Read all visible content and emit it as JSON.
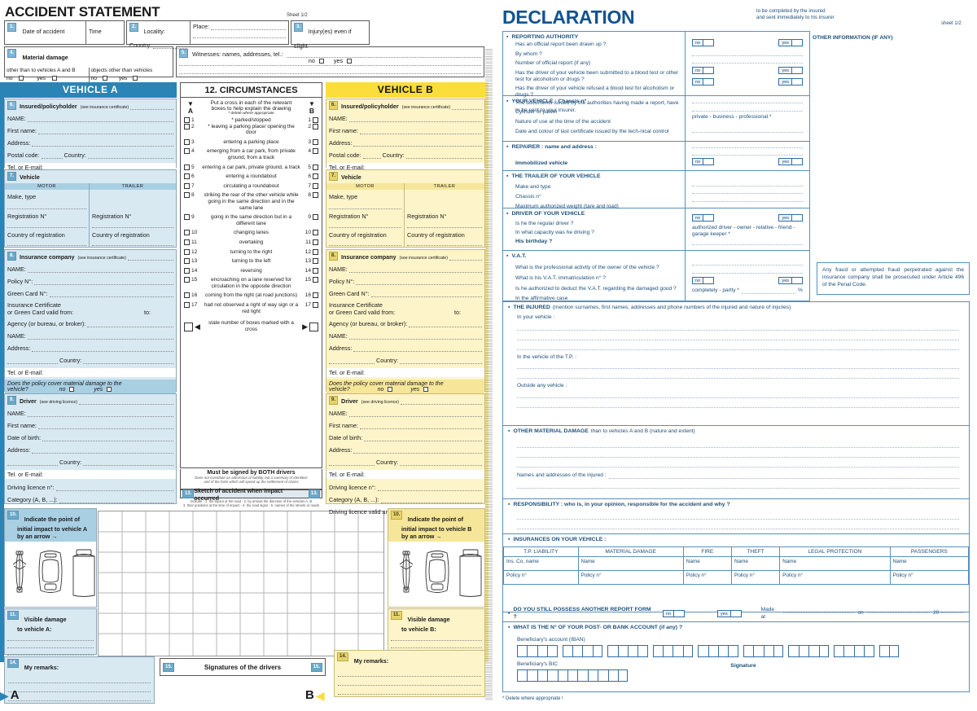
{
  "colors": {
    "blueA": "#2a84b5",
    "yellowB": "#fbdd3c",
    "panelA": "#d9e9f2",
    "panelB": "#fdf4c9",
    "declBlue": "#12538f"
  },
  "left": {
    "title": "ACCIDENT STATEMENT",
    "sheet": "Sheet 1/2",
    "f1": {
      "n": "1.",
      "date_label": "Date of accident",
      "time_label": "Time"
    },
    "f2": {
      "n": "2.",
      "locality_label": "Locality:",
      "country_label": "Country:",
      "place_label": "Place:"
    },
    "f3": {
      "n": "3.",
      "label": "Injury(es) even if slight",
      "no": "no",
      "yes": "yes"
    },
    "f4": {
      "n": "4.",
      "label": "Material damage",
      "opt1": "other than to vehicles A and B",
      "opt2": "objects other than vehicles",
      "no": "no",
      "yes": "yes"
    },
    "f5": {
      "n": "5.",
      "label": "Witnesses: names, addresses, tel.:"
    },
    "vehicle_a_header": "VEHICLE A",
    "vehicle_b_header": "VEHICLE B",
    "f6": {
      "n": "6.",
      "title": "Insured/policyholder",
      "note": "(see insurance certificate)",
      "name": "NAME:",
      "first_name": "First name:",
      "address": "Address:",
      "postal": "Postal code:",
      "country": "Country:",
      "tel": "Tel. or E-mail:"
    },
    "f7": {
      "n": "7.",
      "title": "Vehicle",
      "motor": "MOTOR",
      "trailer": "TRAILER",
      "make": "Make, type",
      "reg": "Registration N°",
      "country_reg": "Country of registration"
    },
    "f8": {
      "n": "8.",
      "title": "Insurance company",
      "note": "(see insurance certificate)",
      "name": "NAME:",
      "policy": "Policy N°:",
      "green_card": "Green Card N°:",
      "cert1": "Insurance Certificate",
      "cert2": "or Green Card valid from:",
      "to": "to:",
      "agency": "Agency (or bureau, or broker):",
      "agency_name": "NAME:",
      "address": "Address:",
      "country": "Country:",
      "tel": "Tel. or E-mail:",
      "cover1": "Does the policy cover material damage to the",
      "cover2": "vehicle?",
      "no": "no",
      "yes": "yes"
    },
    "f9": {
      "n": "9.",
      "title": "Driver",
      "note": "(see driving licence)",
      "name": "NAME:",
      "first_name": "First name:",
      "dob": "Date of birth:",
      "address": "Address:",
      "country": "Country:",
      "tel": "Tel. or E-mail:",
      "licence": "Driving licence n°:",
      "category": "Category (A, B, ...):",
      "valid": "Driving licence valid until:"
    },
    "f10": {
      "n": "10.",
      "l1a": "Indicate the point of",
      "l2a": "initial impact to vehicle A",
      "l2b": "initial impact to vehicle B",
      "l3": "by an arrow →"
    },
    "f11": {
      "n": "11.",
      "l1": "Visible damage",
      "l2a": "to vehicle A:",
      "l2b": "to vehicle B:"
    },
    "f14": {
      "n": "14.",
      "label": "My remarks:"
    },
    "f15": {
      "n": "15.",
      "label": "Signatures of the drivers"
    },
    "marker_a": "A",
    "marker_b": "B",
    "circumstances": {
      "title": "12. CIRCUMSTANCES",
      "instr1": "Put a cross in each of the relevant",
      "instr2": "boxes to help explain the drawing",
      "instr3": "* delete where appropriate",
      "col_a": "A",
      "col_b": "B",
      "items": [
        {
          "n": "1",
          "text": "* parked/stopped"
        },
        {
          "n": "2",
          "text": "* leaving a parking place/ opening the door"
        },
        {
          "n": "3",
          "text": "entering a parking place"
        },
        {
          "n": "4",
          "text": "emerging from a car park, from private ground, from a track"
        },
        {
          "n": "5",
          "text": "entering a car park, private ground, a track"
        },
        {
          "n": "6",
          "text": "entering a roundabout"
        },
        {
          "n": "7",
          "text": "circulating a roundabout"
        },
        {
          "n": "8",
          "text": "striking the rear of the other vehicle while going in the same direction and in the same lane"
        },
        {
          "n": "9",
          "text": "going in the same direction but in a different lane"
        },
        {
          "n": "10",
          "text": "changing lanes"
        },
        {
          "n": "11",
          "text": "overtaking"
        },
        {
          "n": "12",
          "text": "turning to the right"
        },
        {
          "n": "13",
          "text": "turning to the left"
        },
        {
          "n": "14",
          "text": "reversing"
        },
        {
          "n": "15",
          "text": "encroaching on a lane reserved for circulation in the opposite direction"
        },
        {
          "n": "16",
          "text": "coming from the right (at road junctions)"
        },
        {
          "n": "17",
          "text": "had not observed a right of way sign or a red light"
        }
      ],
      "total_text": "state number of boxes marked with a cross"
    },
    "signed_note": {
      "l1": "Must be signed by BOTH drivers",
      "l2": "Does not constitute an admission of liability, but a summary of identities",
      "l3": "and of the facts which will speed up the settlement of claims"
    },
    "f13": {
      "n": "13.",
      "title": "Sketch of accident when impact occurred",
      "note1": "Indicate : 1. the layout of the road - 2. by arrows the direction of the vehicles A, B",
      "note2": "3. their positions at the time of impact - 4. the road signs - 5. names of the streets or roads"
    }
  },
  "right": {
    "title": "DECLARATION",
    "subtitle1": "to be completed by the insured",
    "subtitle2": "and sent immediately to his insurer",
    "sheet": "sheet 1/2",
    "other_info": "OTHER INFORMATION (IF ANY)",
    "no": "no",
    "yes": "yes",
    "reporting": {
      "heading": "REPORTING AUTHORITY",
      "q1": "Has an official report been drawn up ?",
      "q2": "By whom ?",
      "q3": "Number of official report (if any)",
      "q4": "Has the driver of your vehicle been submitted to a blood test or other test for alcoholism or drugs ?",
      "q5": "Has the driver of your vehicle refused a blood test for alcoholism or drugs ?",
      "q6": "The documents issued by the authorities having made a report, have to be sent to your insurer."
    },
    "your_vehicle": {
      "heading": "YOUR VEHICLE : Chassis n°",
      "q1": "Cylinder or power",
      "q2": "Nature of use at the time of the accident",
      "q2_answer": "private - business - professional *",
      "q3": "Date and colour of last certificate issued by the tech-nical control"
    },
    "repairer": {
      "heading": "REPAIRER : name and address :",
      "immobilized": "Immobilized vehicle"
    },
    "trailer": {
      "heading": "THE TRAILER OF YOUR VEHICLE",
      "q1": "Make and type",
      "q2": "Chassis n°",
      "q3": "Maximum authorized weight (tare and load)"
    },
    "driver": {
      "heading": "DRIVER OF YOUR VEHICLE",
      "q1": "Is he the regular driver ?",
      "q2": "In what capacity was he driving ?",
      "q2_answer": "authorized driver - owner - relative - friend - garage keeper *",
      "q3": "His birthday ?"
    },
    "vat": {
      "heading": "V.A.T.",
      "q1": "What is the professional activity of the owner of the vehicle ?",
      "q2": "What is his V.A.T. immatriculation n° ?",
      "q3": "Is he authorized to deduct the V.A.T. regarding the damaged good ?",
      "q4": "In the affirmative case",
      "q4_answer": "completely - partly *",
      "percent": "%"
    },
    "fraud_warning": "Any fraud or attempted fraud perpetrated against the insurance company shall be prosecuted under Article 496 of the Penal Code.",
    "injured": {
      "heading": "THE INJURED",
      "heading_rest": "(mention surnames, first names, addresses and phone numbers of the injured and nature of injuries)",
      "s1": "In your vehicle :",
      "s2": "In the vehicle of the T.P. :",
      "s3": "Outside any vehicle :"
    },
    "other_damage": {
      "heading": "OTHER MATERIAL DAMAGE",
      "heading_rest": "than to vehicles A and B (nature and extent)",
      "names": "Names and addresses of the injured :"
    },
    "responsibility": {
      "heading": "RESPONSIBILITY : who is, in your opinion, responsible for the accident and why ?"
    },
    "insurances": {
      "heading": "INSURANCES ON YOUR VEHICLE :",
      "columns": [
        "T.P. LIABILITY",
        "MATERIAL DAMAGE",
        "FIRE",
        "THEFT",
        "LEGAL PROTECTION",
        "PASSENGERS"
      ],
      "row1": [
        "Ins. Co, name",
        "Name",
        "Name",
        "Name",
        "Name",
        "Name"
      ],
      "row2": [
        "Policy n°",
        "Policy n°",
        "Policy n°",
        "Policy n°",
        "Policy n°",
        "Policy n°"
      ]
    },
    "another_form": {
      "q": "DO YOU STILL POSSESS ANOTHER REPORT FORM ?",
      "made_at": "Made at",
      "on": "on",
      "year": "20"
    },
    "bank": {
      "q": "WHAT IS THE N° OF YOUR POST- OR BANK ACCOUNT (if any) ?",
      "iban_label": "Beneficiary's account (IBAN)",
      "bic_label": "Beneficiary's BIC",
      "signature": "Signature"
    },
    "footnote": "* Delete where appropriate !"
  }
}
